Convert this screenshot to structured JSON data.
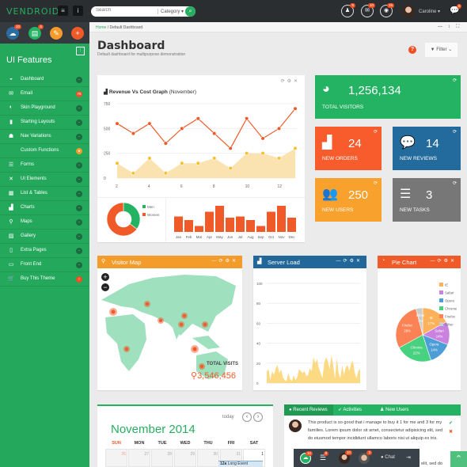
{
  "topbar": {
    "logo": "VENDROID",
    "menu_icon": "hamburger-icon",
    "info_icon": "info-icon",
    "search_placeholder": "Search",
    "category": "Category",
    "user": "Caroline",
    "badges": {
      "team": "5",
      "mail": "10",
      "globe": "15",
      "chat": "8"
    }
  },
  "sidebar": {
    "shortcut_badges": [
      "10",
      "6"
    ],
    "title": "UI Features",
    "items": [
      {
        "label": "Dashboard",
        "icon": "dashboard-icon",
        "badge": "-"
      },
      {
        "label": "Email",
        "icon": "envelope-icon",
        "badge": "78"
      },
      {
        "label": "Skin Playground",
        "icon": "palette-icon",
        "badge": "-"
      },
      {
        "label": "Starting Layouts",
        "icon": "layout-icon",
        "badge": "-"
      },
      {
        "label": "Nav Variations",
        "icon": "sitemap-icon",
        "badge": "-"
      },
      {
        "label": "Custom Functions",
        "icon": "code-icon",
        "badge": "★"
      },
      {
        "label": "Forms",
        "icon": "list-icon",
        "badge": "-"
      },
      {
        "label": "UI Elements",
        "icon": "tools-icon",
        "badge": "-"
      },
      {
        "label": "List & Tables",
        "icon": "table-icon",
        "badge": "-"
      },
      {
        "label": "Charts",
        "icon": "chart-icon",
        "badge": "-"
      },
      {
        "label": "Maps",
        "icon": "map-marker-icon",
        "badge": "-"
      },
      {
        "label": "Gallery",
        "icon": "image-icon",
        "badge": "-"
      },
      {
        "label": "Extra Pages",
        "icon": "file-icon",
        "badge": "-"
      },
      {
        "label": "Front End",
        "icon": "monitor-icon",
        "badge": "-"
      },
      {
        "label": "Buy This Theme",
        "icon": "cart-icon",
        "badge": "!"
      }
    ]
  },
  "breadcrumb": {
    "home": "Home",
    "sep": "/",
    "current": "Default Dashboard"
  },
  "page": {
    "title": "Dashboard",
    "subtitle": "Default dashboard for multipurpose demonstration",
    "filter": "Filter"
  },
  "revenue": {
    "title": "Revenue Vs Cost Graph",
    "period": "(November)"
  },
  "stats": [
    {
      "value": "1,256,134",
      "label": "TOTAL VISITORS",
      "color": "#24b363"
    },
    {
      "value": "24",
      "label": "NEW ORDERS",
      "color": "#f85c2c"
    },
    {
      "value": "14",
      "label": "NEW REVIEWS",
      "color": "#236b9c"
    },
    {
      "value": "250",
      "label": "NEW USERS",
      "color": "#f8a12c"
    },
    {
      "value": "3",
      "label": "NEW TASKS",
      "color": "#777777"
    }
  ],
  "map": {
    "title": "Visitor Map",
    "total_label": "TOTAL VISITS",
    "total": "3,546,456"
  },
  "server": {
    "title": "Server Load"
  },
  "pie": {
    "title": "Pie Chart"
  },
  "calendar": {
    "today": "today",
    "month": "November 2014",
    "days": [
      "SUN",
      "MON",
      "TUE",
      "WED",
      "THU",
      "FRI",
      "SAT"
    ],
    "dates": [
      "26",
      "27",
      "28",
      "29",
      "30",
      "31",
      "1"
    ],
    "event_time": "12a",
    "event": "Long Event"
  },
  "reviews": {
    "tabs": [
      "Recent Reviews",
      "Activities",
      "New Users"
    ],
    "text": "This product is so good that i manage to buy it 1 for me and 3 for my families. Lorem ipsum dolor sit amet, consectetur adipisicing elit, sed do eiusmod tempor incididunt ullamco laboris nisi ut aliquip ex tris.",
    "peek": "elit, sed do"
  },
  "chatbar": {
    "badges": [
      "10",
      "8",
      "10",
      "3"
    ],
    "chat": "Chat"
  },
  "chart_data": [
    {
      "type": "line",
      "name": "revenue-vs-cost",
      "x": [
        2,
        3,
        4,
        5,
        6,
        7,
        8,
        9,
        10,
        11,
        12,
        13
      ],
      "xticks": [
        2,
        4,
        6,
        8,
        10,
        12
      ],
      "yticks": [
        0,
        250,
        500,
        750
      ],
      "ylim": [
        0,
        750
      ],
      "grid": true,
      "series": [
        {
          "values": [
            550,
            450,
            550,
            350,
            500,
            600,
            450,
            300,
            600,
            400,
            500,
            700
          ],
          "color": "#f05a28"
        },
        {
          "values": [
            150,
            50,
            200,
            50,
            150,
            150,
            200,
            100,
            250,
            250,
            200,
            300
          ],
          "color": "#f5c12e",
          "area": "#fae3b0"
        }
      ]
    },
    {
      "type": "pie",
      "name": "gender-donut",
      "legend": [
        "Men",
        "Women"
      ],
      "values": [
        35,
        65
      ],
      "colors": [
        "#24b363",
        "#f05a28"
      ],
      "legend_position": "right"
    },
    {
      "type": "bar",
      "name": "monthly-bars",
      "categories": [
        "Jan",
        "Feb",
        "Mar",
        "Apr",
        "May",
        "Jun",
        "Jul",
        "Aug",
        "Sep",
        "Oct",
        "Nov",
        "Dec"
      ],
      "values": [
        26,
        20,
        10,
        34,
        44,
        24,
        26,
        20,
        10,
        34,
        44,
        24
      ],
      "color": "#f05a28"
    },
    {
      "type": "area",
      "name": "server-load",
      "yticks": [
        0,
        20,
        40,
        60,
        80,
        100
      ],
      "ylim": [
        0,
        100
      ],
      "grid": true,
      "color": "#fcd983",
      "values": [
        12,
        14,
        3,
        12,
        8,
        15,
        18,
        10,
        14,
        6,
        3,
        2,
        10,
        4,
        2,
        8,
        3,
        6,
        14,
        12,
        10,
        12,
        7,
        8,
        15,
        12,
        26,
        20,
        24,
        15,
        10,
        5,
        20,
        26,
        22,
        14,
        28,
        18,
        4,
        25,
        10,
        5,
        18,
        8,
        16,
        18,
        12,
        20,
        22,
        10,
        5,
        12,
        14
      ]
    },
    {
      "type": "pie",
      "name": "browser-share",
      "legend": [
        "IE",
        "Safari",
        "Opera",
        "Chrome",
        "Firefox",
        "Other"
      ],
      "values": [
        17,
        14,
        14,
        22,
        29,
        4
      ],
      "labels": [
        "17%",
        "14%",
        "14%",
        "22%",
        "29%",
        "4%"
      ],
      "colors": [
        "#fbb25a",
        "#c983de",
        "#4d9ed6",
        "#48d17f",
        "#fb8254",
        "#cccccc"
      ],
      "legend_position": "top-right"
    }
  ]
}
